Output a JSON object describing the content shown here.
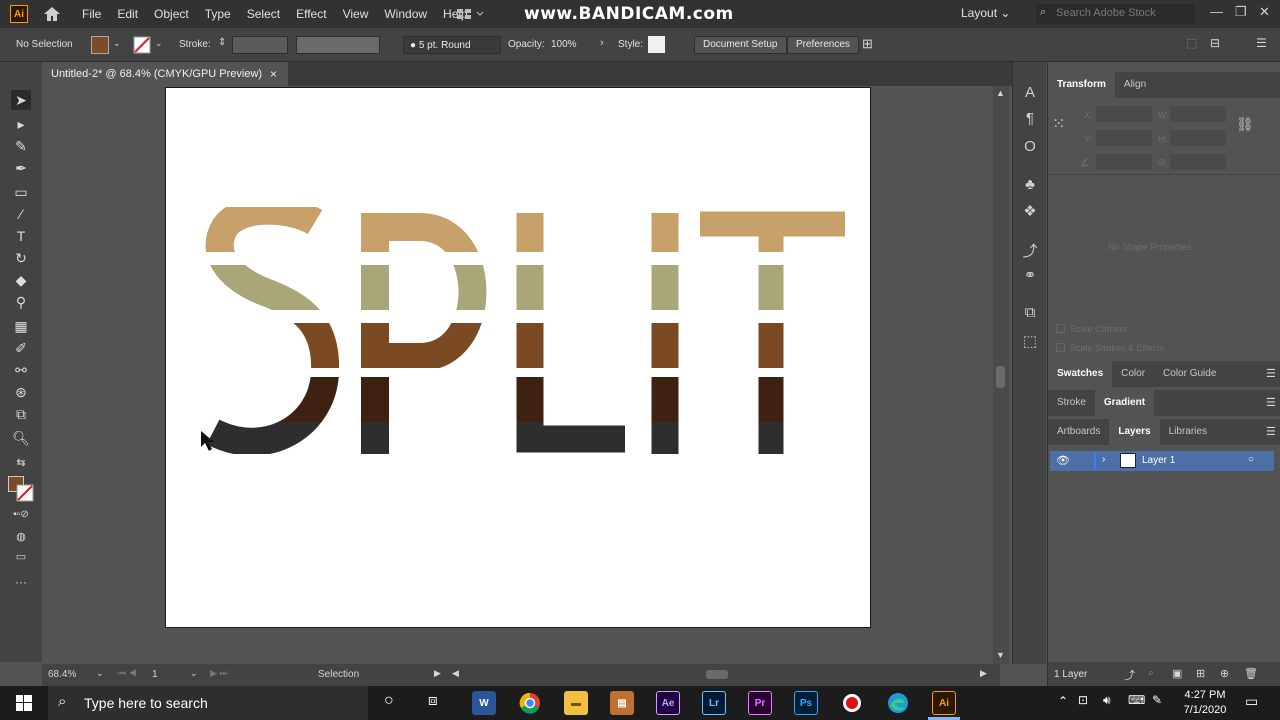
{
  "app": {
    "logo": "Ai",
    "watermark": "www.BANDICAM.com"
  },
  "menu": [
    "File",
    "Edit",
    "Object",
    "Type",
    "Select",
    "Effect",
    "View",
    "Window",
    "Help"
  ],
  "workspace": {
    "label": "Layout",
    "search_placeholder": "Search Adobe Stock"
  },
  "control_bar": {
    "selection": "No Selection",
    "stroke_label": "Stroke:",
    "brush": "5 pt. Round",
    "opacity_label": "Opacity:",
    "opacity_value": "100%",
    "style_label": "Style:",
    "document_setup": "Document Setup",
    "preferences": "Preferences",
    "fill_color": "#7b4a2b"
  },
  "document": {
    "tab_title": "Untitled-2* @ 68.4% (CMYK/GPU Preview)",
    "close": "×"
  },
  "artwork": {
    "text": "SPLIT",
    "band_colors": [
      "#c8a06a",
      "#a9a679",
      "#7b4a22",
      "#3e2110",
      "#2e2e2e"
    ]
  },
  "status_bar": {
    "zoom": "68.4%",
    "artboard_number": "1",
    "tool": "Selection"
  },
  "panels": {
    "transform_tabs": [
      "Transform",
      "Align"
    ],
    "transform_fields": [
      "X:",
      "Y:",
      "W:",
      "H:"
    ],
    "no_shape": "No Shape Properties",
    "scale_corners": "Scale Corners",
    "scale_strokes": "Scale Strokes & Effects",
    "swatch_tabs": [
      "Swatches",
      "Color",
      "Color Guide"
    ],
    "stroke_tabs": [
      "Stroke",
      "Gradient"
    ],
    "layer_tabs": [
      "Artboards",
      "Layers",
      "Libraries"
    ],
    "layer_name": "Layer 1",
    "layer_count": "1 Layer"
  },
  "taskbar": {
    "search_placeholder": "Type here to search",
    "time": "4:27 PM",
    "date": "7/1/2020",
    "apps": [
      "Word",
      "Chrome",
      "Explorer",
      "Archive",
      "Ae",
      "Lr",
      "Pr",
      "Ps",
      "Record",
      "Edge",
      "Ai"
    ]
  }
}
